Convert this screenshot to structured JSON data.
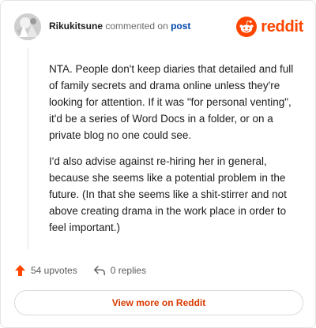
{
  "header": {
    "username": "Rikukitsune",
    "commented_text": "commented on",
    "post_link": "post",
    "brand": "reddit",
    "brand_color": "#ff4500"
  },
  "comment": {
    "paragraphs": [
      "NTA. People don't keep diaries that detailed and full of family secrets and drama online unless they're looking for attention. If it was \"for personal venting\", it'd be a series of Word Docs in a folder, or on a private blog no one could see.",
      "I'd also advise against re-hiring her in general, because she seems like a potential problem in the future. (In that she seems like a shit-stirrer and not above creating drama in the work place in order to feel important.)"
    ]
  },
  "stats": {
    "upvotes": "54 upvotes",
    "replies": "0 replies",
    "upvote_icon": "upvote-arrow-icon",
    "reply_icon": "reply-arrow-icon"
  },
  "footer": {
    "view_more": "View more on Reddit"
  }
}
